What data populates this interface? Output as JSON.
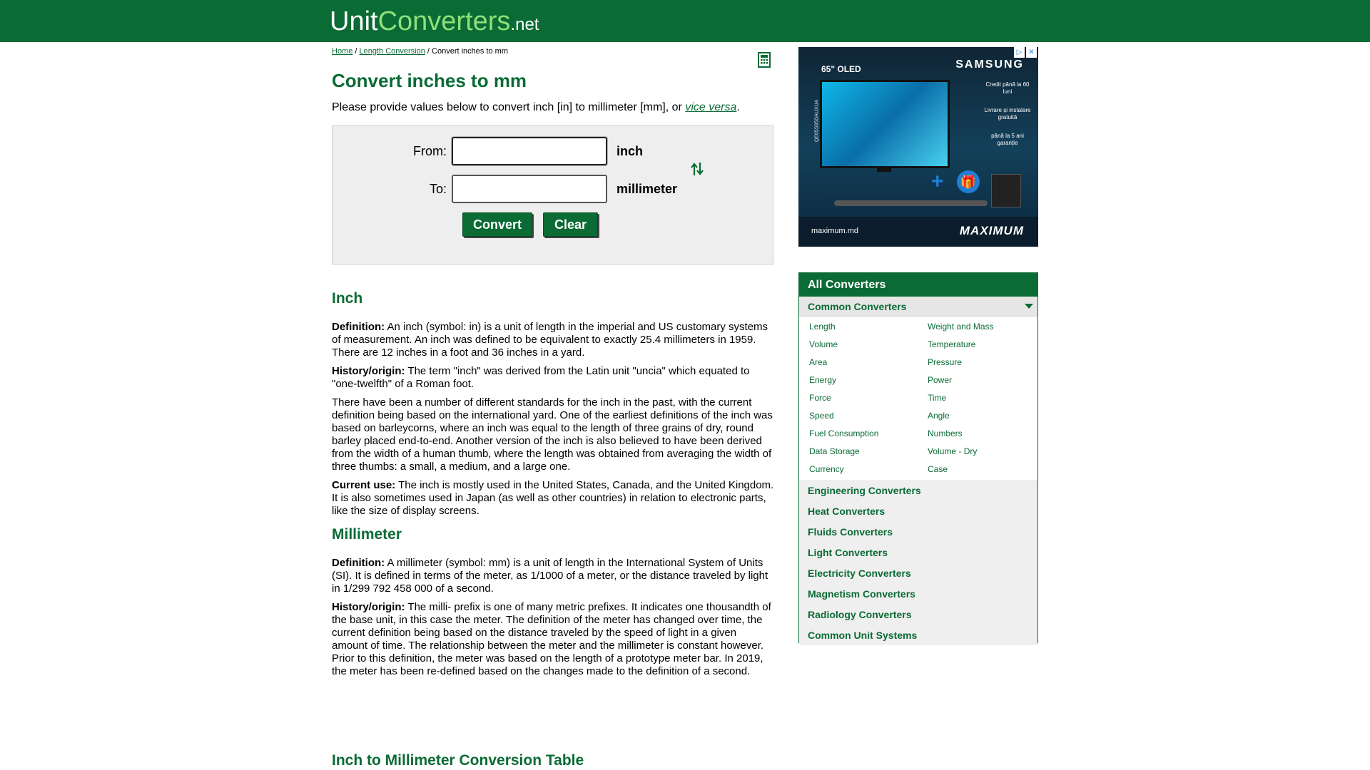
{
  "header": {
    "logo_unit": "Unit",
    "logo_converters": "Converters",
    "logo_tld": ".net"
  },
  "breadcrumb": {
    "home": "Home",
    "sep1": " / ",
    "length": "Length Conversion",
    "sep2": " / ",
    "current": "Convert inches to mm"
  },
  "page": {
    "title": "Convert inches to mm",
    "intro_text": "Please provide values below to convert inch [in] to millimeter [mm], or ",
    "intro_link": "vice versa",
    "intro_end": "."
  },
  "converter": {
    "from_label": "From:",
    "to_label": "To:",
    "from_value": "",
    "to_value": "",
    "from_unit": "inch",
    "to_unit": "millimeter",
    "convert_label": "Convert",
    "clear_label": "Clear"
  },
  "article": {
    "inch_heading": "Inch",
    "inch_def_label": "Definition:",
    "inch_def": " An inch (symbol: in) is a unit of length in the imperial and US customary systems of measurement. An inch was defined to be equivalent to exactly 25.4 millimeters in 1959. There are 12 inches in a foot and 36 inches in a yard.",
    "inch_hist_label": "History/origin:",
    "inch_hist": " The term \"inch\" was derived from the Latin unit \"uncia\" which equated to \"one-twelfth\" of a Roman foot.",
    "inch_para": "There have been a number of different standards for the inch in the past, with the current definition being based on the international yard. One of the earliest definitions of the inch was based on barleycorns, where an inch was equal to the length of three grains of dry, round barley placed end-to-end. Another version of the inch is also believed to have been derived from the width of a human thumb, where the length was obtained from averaging the width of three thumbs: a small, a medium, and a large one.",
    "inch_use_label": "Current use:",
    "inch_use": " The inch is mostly used in the United States, Canada, and the United Kingdom. It is also sometimes used in Japan (as well as other countries) in relation to electronic parts, like the size of display screens.",
    "mm_heading": "Millimeter",
    "mm_def_label": "Definition:",
    "mm_def": " A millimeter (symbol: mm) is a unit of length in the International System of Units (SI). It is defined in terms of the meter, as 1/1000 of a meter, or the distance traveled by light in 1/299 792 458 000 of a second.",
    "mm_hist_label": "History/origin:",
    "mm_hist": " The milli- prefix is one of many metric prefixes. It indicates one thousandth of the base unit, in this case the meter. The definition of the meter has changed over time, the current definition being based on the distance traveled by the speed of light in a given amount of time. The relationship between the meter and the millimeter is constant however. Prior to this definition, the meter was based on the length of a prototype meter bar. In 2019, the meter has been re-defined based on the changes made to the definition of a second.",
    "table_heading": "Inch to Millimeter Conversion Table"
  },
  "ad": {
    "size_label": "65\" OLED",
    "brand": "SAMSUNG",
    "side_text_1": "Credit până la 60 luni",
    "side_text_2": "Livrare și instalare gratuită",
    "side_text_3": "până la 5 ani garanție",
    "vertical_code": "QE65S95DAUXUA",
    "site": "maximum.md",
    "logo": "MAXIMUM",
    "close": "✕",
    "adchoices": "▷"
  },
  "sidebar": {
    "header": "All Converters",
    "common": "Common Converters",
    "common_items": [
      "Length",
      "Weight and Mass",
      "Volume",
      "Temperature",
      "Area",
      "Pressure",
      "Energy",
      "Power",
      "Force",
      "Time",
      "Speed",
      "Angle",
      "Fuel Consumption",
      "Numbers",
      "Data Storage",
      "Volume - Dry",
      "Currency",
      "Case"
    ],
    "categories": [
      "Engineering Converters",
      "Heat Converters",
      "Fluids Converters",
      "Light Converters",
      "Electricity Converters",
      "Magnetism Converters",
      "Radiology Converters",
      "Common Unit Systems"
    ]
  },
  "colors": {
    "brand_green": "#0a6b34",
    "logo_light_green": "#8ee07a",
    "panel_bg": "#efefef"
  }
}
